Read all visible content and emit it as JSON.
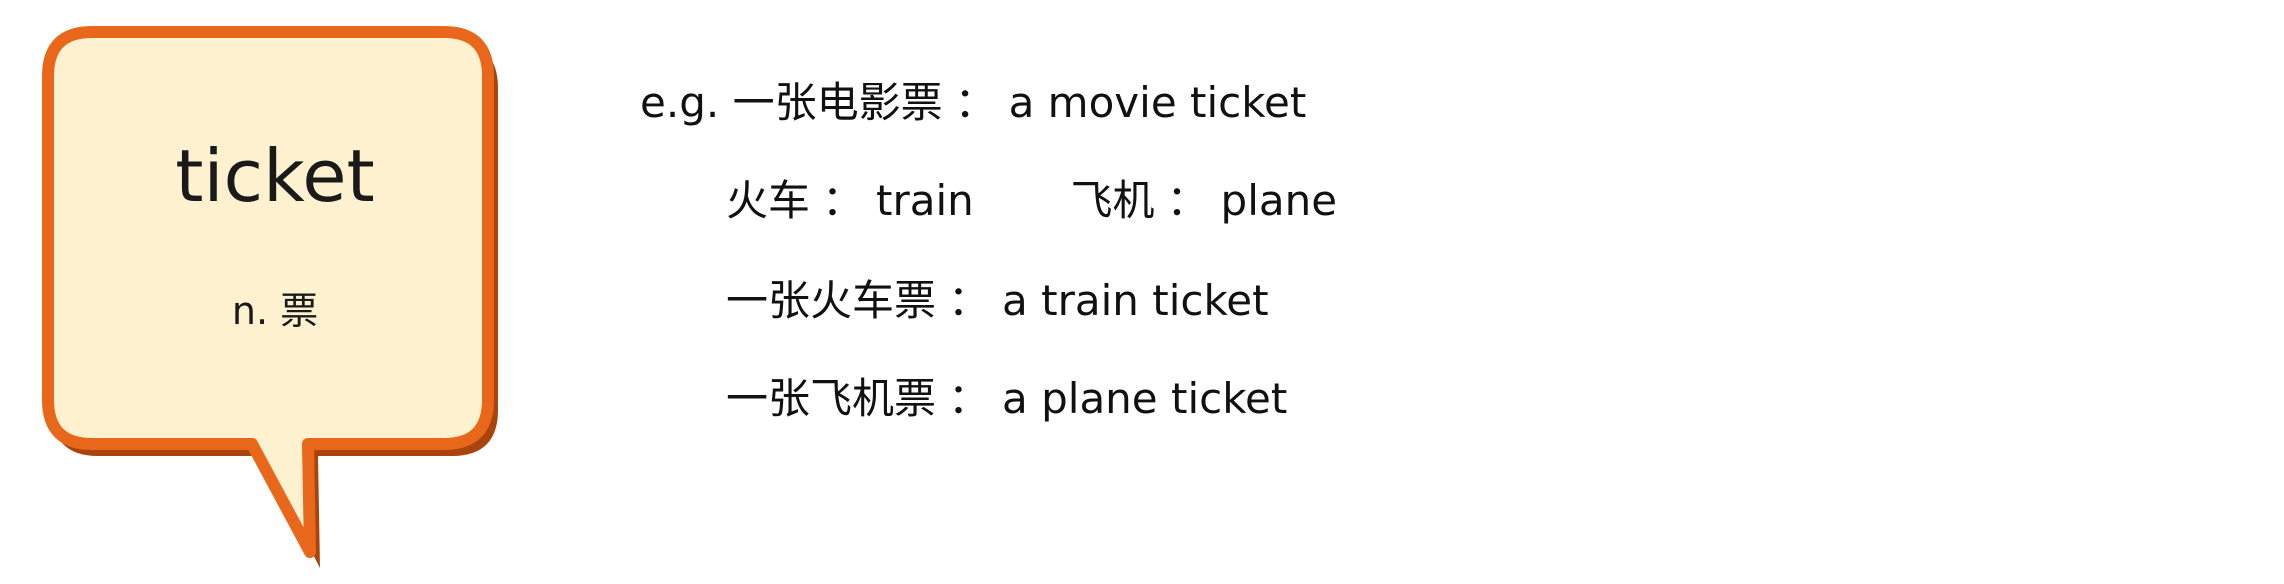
{
  "card": {
    "word": "ticket",
    "part_of_speech": "n. 票",
    "border_color": "#e8671a",
    "shadow_color": "#a9440c",
    "fill_color": "#fdf1cf"
  },
  "examples": {
    "prefix": "e.g.",
    "line1": {
      "cn": "一张电影票",
      "sep": "：",
      "en": "a movie ticket"
    },
    "line2a": {
      "cn": "火车",
      "sep": "：",
      "en": "train"
    },
    "line2b": {
      "cn": "飞机",
      "sep": "：",
      "en": "plane"
    },
    "line3": {
      "cn": "一张火车票",
      "sep": "：",
      "en": "a train ticket"
    },
    "line4": {
      "cn": "一张飞机票",
      "sep": "：",
      "en": "a plane ticket"
    }
  }
}
